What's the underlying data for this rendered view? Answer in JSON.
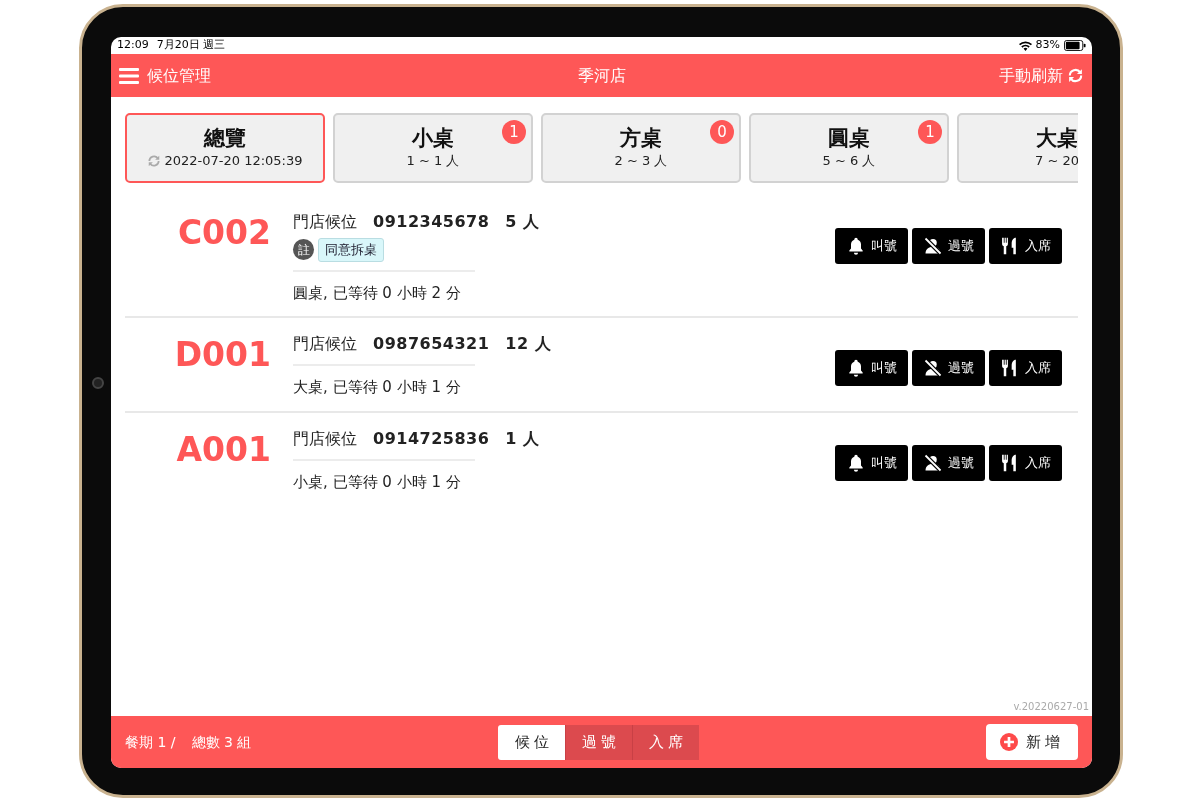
{
  "status_bar": {
    "time": "12:09",
    "date": "7月20日 週三",
    "battery": "83%"
  },
  "header": {
    "menu_label": "候位管理",
    "store": "季河店",
    "refresh_label": "手動刷新"
  },
  "tabs": [
    {
      "kind": "overview",
      "title": "總覽",
      "subtitle": "2022-07-20 12:05:39",
      "selected": true
    },
    {
      "kind": "table",
      "title": "小桌",
      "subtitle": "1 ~ 1 人",
      "badge": "1",
      "selected": false
    },
    {
      "kind": "table",
      "title": "方桌",
      "subtitle": "2 ~ 3 人",
      "badge": "0",
      "selected": false
    },
    {
      "kind": "table",
      "title": "圓桌",
      "subtitle": "5 ~ 6 人",
      "badge": "1",
      "selected": false
    },
    {
      "kind": "table",
      "title": "大桌",
      "subtitle": "7 ~ 20",
      "selected": false
    }
  ],
  "queue": [
    {
      "number": "C002",
      "source": "門店候位",
      "phone": "0912345678",
      "party": "5 人",
      "note_label": "註",
      "note": "同意拆桌",
      "wait": "圓桌, 已等待 0 小時 2 分",
      "actions": [
        {
          "kind": "call",
          "label": "叫號"
        },
        {
          "kind": "skip",
          "label": "過號"
        },
        {
          "kind": "seat",
          "label": "入席"
        }
      ]
    },
    {
      "number": "D001",
      "source": "門店候位",
      "phone": "0987654321",
      "party": "12 人",
      "wait": "大桌, 已等待 0 小時 1 分",
      "actions": [
        {
          "kind": "call",
          "label": "叫號"
        },
        {
          "kind": "skip",
          "label": "過號"
        },
        {
          "kind": "seat",
          "label": "入席"
        }
      ]
    },
    {
      "number": "A001",
      "source": "門店候位",
      "phone": "0914725836",
      "party": "1 人",
      "wait": "小桌, 已等待 0 小時 1 分",
      "actions": [
        {
          "kind": "call",
          "label": "叫號"
        },
        {
          "kind": "skip",
          "label": "過號"
        },
        {
          "kind": "seat",
          "label": "入席"
        }
      ]
    }
  ],
  "version": "v.20220627-01",
  "footer": {
    "meal_period": "餐期 1 /",
    "total": "總數 3 組",
    "segments": [
      {
        "label": "候位",
        "selected": true
      },
      {
        "label": "過號",
        "selected": false
      },
      {
        "label": "入席",
        "selected": false
      }
    ],
    "add_label": "新增"
  }
}
